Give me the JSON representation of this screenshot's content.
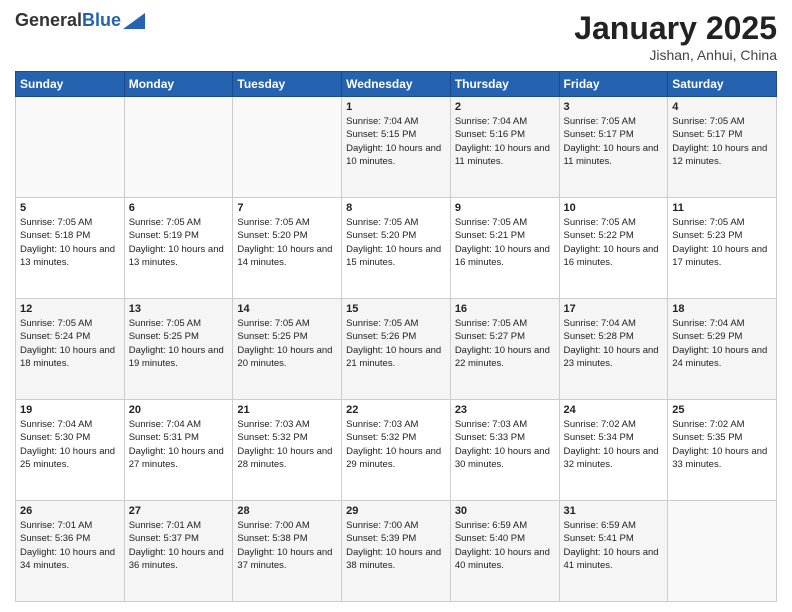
{
  "header": {
    "logo_general": "General",
    "logo_blue": "Blue",
    "month_title": "January 2025",
    "location": "Jishan, Anhui, China"
  },
  "days_of_week": [
    "Sunday",
    "Monday",
    "Tuesday",
    "Wednesday",
    "Thursday",
    "Friday",
    "Saturday"
  ],
  "weeks": [
    [
      {
        "day": "",
        "sunrise": "",
        "sunset": "",
        "daylight": ""
      },
      {
        "day": "",
        "sunrise": "",
        "sunset": "",
        "daylight": ""
      },
      {
        "day": "",
        "sunrise": "",
        "sunset": "",
        "daylight": ""
      },
      {
        "day": "1",
        "sunrise": "Sunrise: 7:04 AM",
        "sunset": "Sunset: 5:15 PM",
        "daylight": "Daylight: 10 hours and 10 minutes."
      },
      {
        "day": "2",
        "sunrise": "Sunrise: 7:04 AM",
        "sunset": "Sunset: 5:16 PM",
        "daylight": "Daylight: 10 hours and 11 minutes."
      },
      {
        "day": "3",
        "sunrise": "Sunrise: 7:05 AM",
        "sunset": "Sunset: 5:17 PM",
        "daylight": "Daylight: 10 hours and 11 minutes."
      },
      {
        "day": "4",
        "sunrise": "Sunrise: 7:05 AM",
        "sunset": "Sunset: 5:17 PM",
        "daylight": "Daylight: 10 hours and 12 minutes."
      }
    ],
    [
      {
        "day": "5",
        "sunrise": "Sunrise: 7:05 AM",
        "sunset": "Sunset: 5:18 PM",
        "daylight": "Daylight: 10 hours and 13 minutes."
      },
      {
        "day": "6",
        "sunrise": "Sunrise: 7:05 AM",
        "sunset": "Sunset: 5:19 PM",
        "daylight": "Daylight: 10 hours and 13 minutes."
      },
      {
        "day": "7",
        "sunrise": "Sunrise: 7:05 AM",
        "sunset": "Sunset: 5:20 PM",
        "daylight": "Daylight: 10 hours and 14 minutes."
      },
      {
        "day": "8",
        "sunrise": "Sunrise: 7:05 AM",
        "sunset": "Sunset: 5:20 PM",
        "daylight": "Daylight: 10 hours and 15 minutes."
      },
      {
        "day": "9",
        "sunrise": "Sunrise: 7:05 AM",
        "sunset": "Sunset: 5:21 PM",
        "daylight": "Daylight: 10 hours and 16 minutes."
      },
      {
        "day": "10",
        "sunrise": "Sunrise: 7:05 AM",
        "sunset": "Sunset: 5:22 PM",
        "daylight": "Daylight: 10 hours and 16 minutes."
      },
      {
        "day": "11",
        "sunrise": "Sunrise: 7:05 AM",
        "sunset": "Sunset: 5:23 PM",
        "daylight": "Daylight: 10 hours and 17 minutes."
      }
    ],
    [
      {
        "day": "12",
        "sunrise": "Sunrise: 7:05 AM",
        "sunset": "Sunset: 5:24 PM",
        "daylight": "Daylight: 10 hours and 18 minutes."
      },
      {
        "day": "13",
        "sunrise": "Sunrise: 7:05 AM",
        "sunset": "Sunset: 5:25 PM",
        "daylight": "Daylight: 10 hours and 19 minutes."
      },
      {
        "day": "14",
        "sunrise": "Sunrise: 7:05 AM",
        "sunset": "Sunset: 5:25 PM",
        "daylight": "Daylight: 10 hours and 20 minutes."
      },
      {
        "day": "15",
        "sunrise": "Sunrise: 7:05 AM",
        "sunset": "Sunset: 5:26 PM",
        "daylight": "Daylight: 10 hours and 21 minutes."
      },
      {
        "day": "16",
        "sunrise": "Sunrise: 7:05 AM",
        "sunset": "Sunset: 5:27 PM",
        "daylight": "Daylight: 10 hours and 22 minutes."
      },
      {
        "day": "17",
        "sunrise": "Sunrise: 7:04 AM",
        "sunset": "Sunset: 5:28 PM",
        "daylight": "Daylight: 10 hours and 23 minutes."
      },
      {
        "day": "18",
        "sunrise": "Sunrise: 7:04 AM",
        "sunset": "Sunset: 5:29 PM",
        "daylight": "Daylight: 10 hours and 24 minutes."
      }
    ],
    [
      {
        "day": "19",
        "sunrise": "Sunrise: 7:04 AM",
        "sunset": "Sunset: 5:30 PM",
        "daylight": "Daylight: 10 hours and 25 minutes."
      },
      {
        "day": "20",
        "sunrise": "Sunrise: 7:04 AM",
        "sunset": "Sunset: 5:31 PM",
        "daylight": "Daylight: 10 hours and 27 minutes."
      },
      {
        "day": "21",
        "sunrise": "Sunrise: 7:03 AM",
        "sunset": "Sunset: 5:32 PM",
        "daylight": "Daylight: 10 hours and 28 minutes."
      },
      {
        "day": "22",
        "sunrise": "Sunrise: 7:03 AM",
        "sunset": "Sunset: 5:32 PM",
        "daylight": "Daylight: 10 hours and 29 minutes."
      },
      {
        "day": "23",
        "sunrise": "Sunrise: 7:03 AM",
        "sunset": "Sunset: 5:33 PM",
        "daylight": "Daylight: 10 hours and 30 minutes."
      },
      {
        "day": "24",
        "sunrise": "Sunrise: 7:02 AM",
        "sunset": "Sunset: 5:34 PM",
        "daylight": "Daylight: 10 hours and 32 minutes."
      },
      {
        "day": "25",
        "sunrise": "Sunrise: 7:02 AM",
        "sunset": "Sunset: 5:35 PM",
        "daylight": "Daylight: 10 hours and 33 minutes."
      }
    ],
    [
      {
        "day": "26",
        "sunrise": "Sunrise: 7:01 AM",
        "sunset": "Sunset: 5:36 PM",
        "daylight": "Daylight: 10 hours and 34 minutes."
      },
      {
        "day": "27",
        "sunrise": "Sunrise: 7:01 AM",
        "sunset": "Sunset: 5:37 PM",
        "daylight": "Daylight: 10 hours and 36 minutes."
      },
      {
        "day": "28",
        "sunrise": "Sunrise: 7:00 AM",
        "sunset": "Sunset: 5:38 PM",
        "daylight": "Daylight: 10 hours and 37 minutes."
      },
      {
        "day": "29",
        "sunrise": "Sunrise: 7:00 AM",
        "sunset": "Sunset: 5:39 PM",
        "daylight": "Daylight: 10 hours and 38 minutes."
      },
      {
        "day": "30",
        "sunrise": "Sunrise: 6:59 AM",
        "sunset": "Sunset: 5:40 PM",
        "daylight": "Daylight: 10 hours and 40 minutes."
      },
      {
        "day": "31",
        "sunrise": "Sunrise: 6:59 AM",
        "sunset": "Sunset: 5:41 PM",
        "daylight": "Daylight: 10 hours and 41 minutes."
      },
      {
        "day": "",
        "sunrise": "",
        "sunset": "",
        "daylight": ""
      }
    ]
  ]
}
